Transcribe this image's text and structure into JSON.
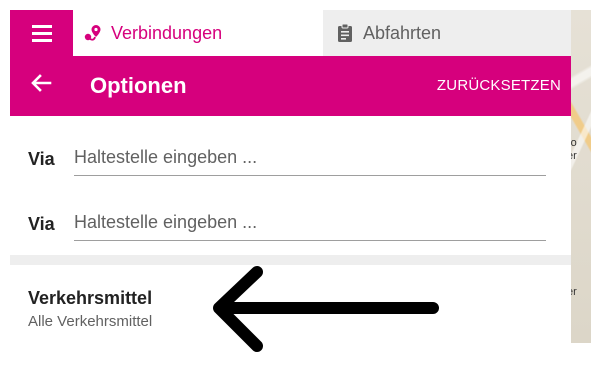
{
  "tabs": {
    "connections_label": "Verbindungen",
    "departures_label": "Abfahrten"
  },
  "header": {
    "title": "Optionen",
    "reset_label": "ZURÜCKSETZEN"
  },
  "via_fields": [
    {
      "label": "Via",
      "placeholder": "Haltestelle eingeben ..."
    },
    {
      "label": "Via",
      "placeholder": "Haltestelle eingeben ..."
    }
  ],
  "transport": {
    "title": "Verkehrsmittel",
    "subtitle": "Alle Verkehrsmittel"
  },
  "map": {
    "labels": [
      "ro",
      "er",
      "er"
    ]
  },
  "colors": {
    "accent": "#d6007d",
    "tab_background": "#eeeeee"
  },
  "icons": {
    "menu": "hamburger-menu-icon",
    "connections": "route-pin-icon",
    "departures": "clipboard-icon",
    "back": "arrow-left-icon",
    "annotation": "arrow-left-annotation"
  }
}
